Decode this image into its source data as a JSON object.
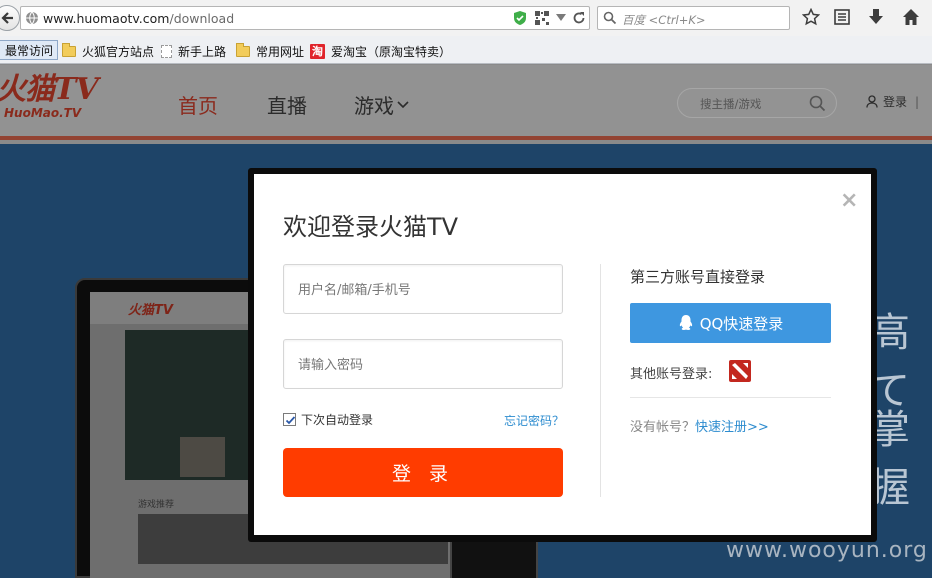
{
  "browser": {
    "url_host": "www.huomaotv.com",
    "url_path": "/download",
    "search_placeholder": "百度 <Ctrl+K>",
    "bookmarks": [
      "最常访问",
      "火狐官方站点",
      "新手上路",
      "常用网址",
      "爱淘宝（原淘宝特卖）"
    ]
  },
  "site": {
    "logo_text": "火猫TV",
    "logo_sub": "HuoMao.TV",
    "nav": [
      "首页",
      "直播",
      "游戏"
    ],
    "search_placeholder": "搜主播/游戏",
    "login_link": "登录",
    "login_sep": "|"
  },
  "hero": {
    "laptop_logo": "火猫TV",
    "laptop_label": "游戏推荐",
    "text_right_1": "高て",
    "text_right_2": "掌握",
    "watermark": "www.wooyun.org"
  },
  "modal": {
    "close": "×",
    "title": "欢迎登录火猫TV",
    "username_placeholder": "用户名/邮箱/手机号",
    "password_placeholder": "请输入密码",
    "remember_label": "下次自动登录",
    "forgot_label": "忘记密码？",
    "login_button": "登 录",
    "third_party_title": "第三方账号直接登录",
    "qq_button": "QQ快速登录",
    "other_accounts_label": "其他账号登录:",
    "no_account_text": "没有帐号？",
    "register_link": "快速注册>>"
  },
  "colors": {
    "login_button": "#ff3c00",
    "qq_button": "#3e97e0",
    "link": "#2d8ccf"
  }
}
